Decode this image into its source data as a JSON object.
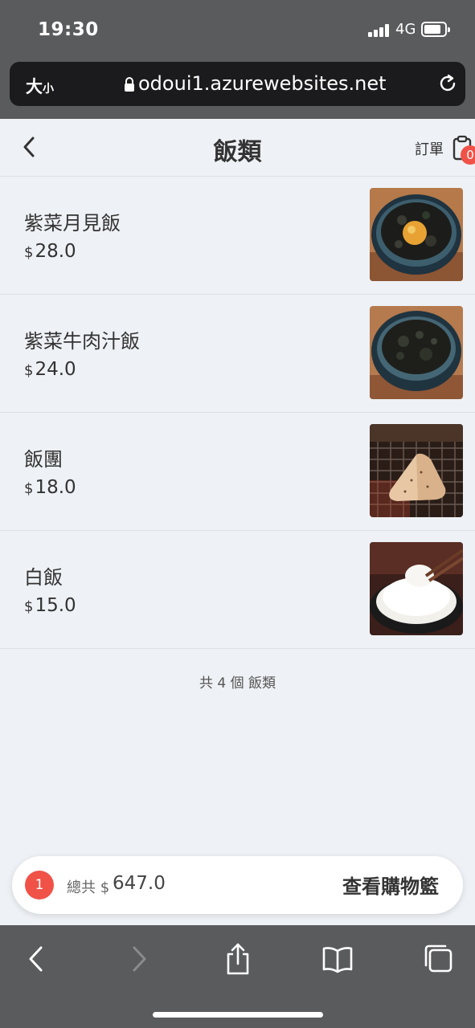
{
  "status_bar": {
    "time": "19:30",
    "network": "4G"
  },
  "browser": {
    "text_size_label": "大",
    "text_size_small": "小",
    "url": "odoui1.azurewebsites.net"
  },
  "header": {
    "title": "飯類",
    "order_label": "訂單",
    "order_count": "0"
  },
  "items": [
    {
      "name": "紫菜月見飯",
      "currency": "$",
      "price": "28.0",
      "image_icon": "rice-bowl-with-egg-yolk"
    },
    {
      "name": "紫菜牛肉汁飯",
      "currency": "$",
      "price": "24.0",
      "image_icon": "seaweed-rice-bowl"
    },
    {
      "name": "飯團",
      "currency": "$",
      "price": "18.0",
      "image_icon": "grilled-rice-ball"
    },
    {
      "name": "白飯",
      "currency": "$",
      "price": "15.0",
      "image_icon": "white-rice-bowl"
    }
  ],
  "summary": "共 4 個 飯類",
  "cart": {
    "count": "1",
    "total_label": "總共",
    "currency": "$",
    "total_value": "647.0",
    "view_cart_label": "查看購物籃"
  },
  "colors": {
    "accent_red": "#f05248",
    "chrome_gray": "#5a5b5d",
    "page_bg": "#eef1f5"
  }
}
